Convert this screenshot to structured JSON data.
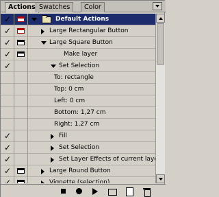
{
  "tabs": {
    "actions": "Actions",
    "swatches": "Swatches",
    "color": "Color"
  },
  "rows": [
    {
      "label": "Default Actions",
      "checked": true,
      "dialog": "red",
      "expand": "down",
      "kind": "set"
    },
    {
      "label": "Large Rectangular Button",
      "checked": true,
      "dialog": "red",
      "expand": "right",
      "kind": "action"
    },
    {
      "label": "Large Square Button",
      "checked": true,
      "dialog": "black",
      "expand": "down",
      "kind": "action"
    },
    {
      "label": "Make layer",
      "checked": true,
      "dialog": "black",
      "expand": "none",
      "kind": "command"
    },
    {
      "label": "Set Selection",
      "checked": true,
      "dialog": "none",
      "expand": "down",
      "kind": "command"
    },
    {
      "label": "To: rectangle",
      "kind": "param"
    },
    {
      "label": "Top: 0 cm",
      "kind": "param"
    },
    {
      "label": "Left: 0 cm",
      "kind": "param"
    },
    {
      "label": "Bottom: 1,27 cm",
      "kind": "param"
    },
    {
      "label": "Right: 1,27 cm",
      "kind": "param"
    },
    {
      "label": "Fill",
      "checked": true,
      "dialog": "none",
      "expand": "right",
      "kind": "command"
    },
    {
      "label": "Set Selection",
      "checked": true,
      "dialog": "none",
      "expand": "right",
      "kind": "command"
    },
    {
      "label": "Set Layer Effects of current laye",
      "checked": true,
      "dialog": "none",
      "expand": "right",
      "kind": "command"
    },
    {
      "label": "Large Round Button",
      "checked": true,
      "dialog": "black",
      "expand": "right",
      "kind": "action"
    },
    {
      "label": "Vignette (selection)",
      "checked": true,
      "dialog": "black",
      "expand": "right",
      "kind": "action"
    }
  ]
}
